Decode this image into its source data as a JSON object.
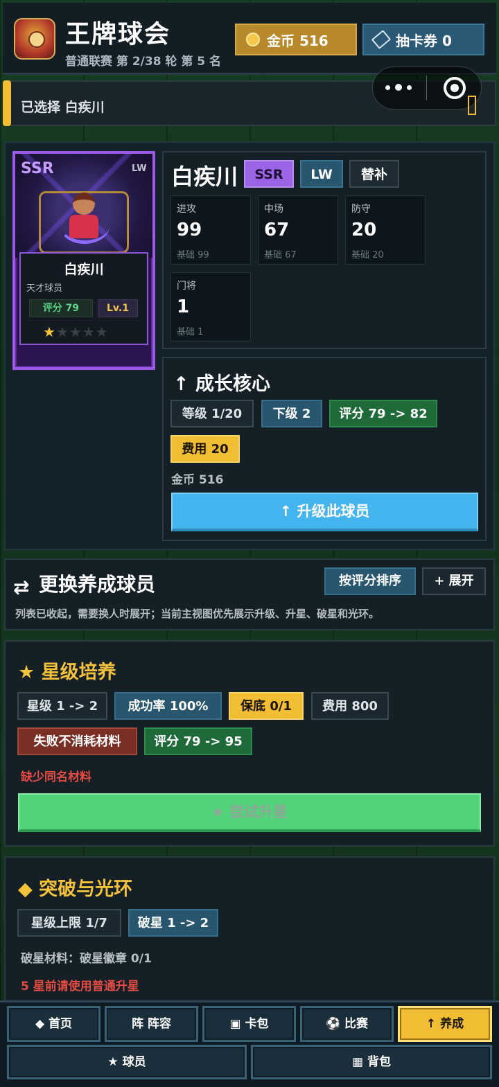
{
  "header": {
    "title": "王牌球会",
    "subtitle": "普通联赛 第 2/38 轮 第 5 名",
    "coins_label": "金币 516",
    "tickets_label": "抽卡券 0"
  },
  "banner": {
    "selected_text": "已选择 白疾川"
  },
  "card": {
    "rarity": "SSR",
    "position": "LW",
    "name": "白疾川",
    "subtitle": "天才球员",
    "score": "评分 79",
    "level": "Lv.1",
    "stars_filled": 1,
    "stars_total": 5
  },
  "player": {
    "name": "白疾川",
    "rarity_tag": "SSR",
    "position_tag": "LW",
    "role_tag": "替补",
    "stats": [
      {
        "label": "进攻",
        "value": "99",
        "base": "基础 99"
      },
      {
        "label": "中场",
        "value": "67",
        "base": "基础 67"
      },
      {
        "label": "防守",
        "value": "20",
        "base": "基础 20"
      },
      {
        "label": "门将",
        "value": "1",
        "base": "基础 1"
      }
    ]
  },
  "growth": {
    "title": "↑ 成长核心",
    "level": "等级 1/20",
    "next": "下级 2",
    "score": "评分 79 -> 82",
    "cost": "费用 20",
    "gold": "金币 516",
    "upgrade_button": "↑ 升级此球员"
  },
  "swap": {
    "icon": "⇄",
    "title": "更换养成球员",
    "sort_button": "按评分排序",
    "expand_button": "+ 展开",
    "description": "列表已收起，需要换人时展开；当前主视图优先展示升级、升星、破星和光环。"
  },
  "star_training": {
    "title": "★ 星级培养",
    "chips": [
      "星级 1 -> 2",
      "成功率 100%",
      "保底 0/1",
      "费用 800",
      "失败不消耗材料",
      "评分 79 -> 95"
    ],
    "warning": "缺少同名材料",
    "try_button": "★ 尝试升星"
  },
  "breakthrough": {
    "title": "◆ 突破与光环",
    "chips": [
      "星级上限 1/7",
      "破星 1 -> 2"
    ],
    "materials": "破星材料：破星徽章 0/1",
    "warning": "5 星前请使用普通升星"
  },
  "nav": {
    "items": [
      {
        "label": "◆ 首页"
      },
      {
        "label": "阵 阵容"
      },
      {
        "label": "▣ 卡包"
      },
      {
        "label": "⚽ 比赛"
      },
      {
        "label": "↑ 养成"
      }
    ],
    "wide_items": [
      {
        "label": "★ 球员"
      },
      {
        "label": "▦ 背包"
      }
    ]
  },
  "colors": {
    "accent_gold": "#f1bd32",
    "primary_blue": "#43b4ee",
    "success_green": "#52d37a",
    "warning_red": "#e84b44",
    "ssr_purple": "#9b63e6"
  }
}
